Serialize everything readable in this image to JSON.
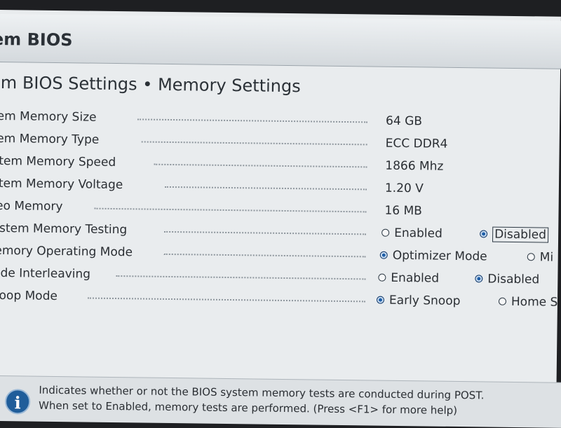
{
  "app_title": "tem BIOS",
  "page_title": "tem BIOS Settings • Memory Settings",
  "settings": [
    {
      "label": "stem Memory Size",
      "value": "64 GB"
    },
    {
      "label": "stem Memory Type",
      "value": "ECC DDR4"
    },
    {
      "label": "ystem Memory Speed",
      "value": "1866 Mhz"
    },
    {
      "label": "ystem Memory Voltage",
      "value": "1.20 V"
    },
    {
      "label": "ideo Memory",
      "value": "16 MB"
    },
    {
      "label": "System Memory Testing",
      "options": [
        "Enabled",
        "Disabled"
      ],
      "selected": "Disabled"
    },
    {
      "label": "Memory Operating Mode",
      "options": [
        "Optimizer Mode",
        "Mi"
      ],
      "selected": "Optimizer Mode"
    },
    {
      "label": "Node Interleaving",
      "options": [
        "Enabled",
        "Disabled"
      ],
      "selected": "Disabled"
    },
    {
      "label": "Snoop Mode",
      "options": [
        "Early Snoop",
        "Home S"
      ],
      "selected": "Early Snoop"
    }
  ],
  "help": {
    "icon": "info-icon",
    "line1": "Indicates whether or not the BIOS system memory tests are conducted during POST.",
    "line2": "When set to Enabled, memory tests are performed. (Press <F1> for more help)"
  },
  "colors": {
    "background": "#e9ecee",
    "radio_selected": "#1f5fa8",
    "info_icon": "#1f5d9a"
  }
}
